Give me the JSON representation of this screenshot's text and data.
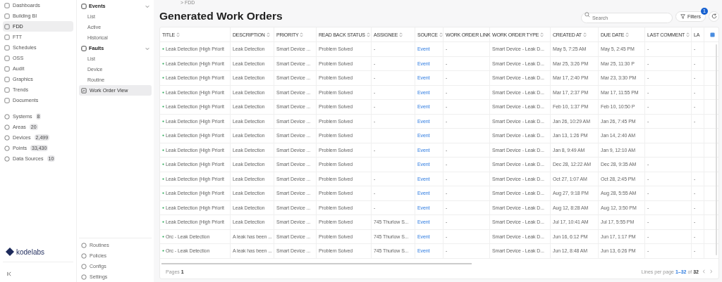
{
  "sidebar": {
    "items": [
      {
        "label": "Dashboards",
        "selected": false
      },
      {
        "label": "Building BI",
        "selected": false
      },
      {
        "label": "FDD",
        "selected": true
      },
      {
        "label": "FTT",
        "selected": false
      },
      {
        "label": "Schedules",
        "selected": false
      },
      {
        "label": "OSS",
        "selected": false
      },
      {
        "label": "Audit",
        "selected": false
      },
      {
        "label": "Graphics",
        "selected": false
      },
      {
        "label": "Trends",
        "selected": false
      },
      {
        "label": "Documents",
        "selected": false
      }
    ],
    "counters": [
      {
        "label": "Systems",
        "count": "8"
      },
      {
        "label": "Areas",
        "count": "20"
      },
      {
        "label": "Devices",
        "count": "2,499"
      },
      {
        "label": "Points",
        "count": "33,430"
      },
      {
        "label": "Data Sources",
        "count": "10"
      }
    ],
    "logo": "**kode**labs"
  },
  "subnav": {
    "groups": [
      {
        "label": "Events",
        "expanded": true,
        "children": [
          {
            "label": "List",
            "selected": false
          },
          {
            "label": "Active",
            "selected": false
          },
          {
            "label": "Historical",
            "selected": false
          }
        ]
      },
      {
        "label": "Faults",
        "expanded": true,
        "children": [
          {
            "label": "List",
            "selected": false
          },
          {
            "label": "Device",
            "selected": false
          },
          {
            "label": "Routine",
            "selected": false
          }
        ]
      }
    ],
    "items": [
      {
        "label": "Work Order View",
        "selected": true
      }
    ],
    "bottom": [
      "Routines",
      "Policies",
      "Configs",
      "Settings"
    ]
  },
  "breadcrumb": "> FDD",
  "title": "Generated Work Orders",
  "search": {
    "placeholder": "Search"
  },
  "filters": {
    "label": "Filters",
    "badge": "1"
  },
  "table": {
    "columns": [
      {
        "label": "TITLE",
        "sortable": true
      },
      {
        "label": "DESCRIPTION",
        "sortable": true
      },
      {
        "label": "PRIORITY",
        "sortable": true
      },
      {
        "label": "READ BACK STATUS",
        "sortable": true
      },
      {
        "label": "ASSIGNEE",
        "sortable": true
      },
      {
        "label": "SOURCE",
        "sortable": true
      },
      {
        "label": "WORK ORDER LINK",
        "sortable": false
      },
      {
        "label": "WORK ORDER TYPE",
        "sortable": true
      },
      {
        "label": "CREATED AT",
        "sortable": true
      },
      {
        "label": "DUE DATE",
        "sortable": true
      },
      {
        "label": "LAST COMMENT",
        "sortable": true
      },
      {
        "label": "LA",
        "sortable": false
      }
    ],
    "rows": [
      [
        "Leak Detection (High Priorit",
        "Leak Detection",
        "Smart Device ...",
        "Problem Solved",
        "-",
        "Event",
        "-",
        "Smart Device - Leak D...",
        "May 5, 7:25 AM",
        "May 5, 2:45 PM",
        "-",
        "-"
      ],
      [
        "Leak Detection (High Priorit",
        "Leak Detection",
        "Smart Device ...",
        "Problem Solved",
        "-",
        "Event",
        "-",
        "Smart Device - Leak D...",
        "Mar 25, 3:26 PM",
        "Mar 25, 11:30 P",
        "-",
        "-"
      ],
      [
        "Leak Detection (High Priorit",
        "Leak Detection",
        "Smart Device ...",
        "Problem Solved",
        "-",
        "Event",
        "-",
        "Smart Device - Leak D...",
        "Mar 17, 2:40 PM",
        "Mar 23, 3:30 PM",
        "-",
        "-"
      ],
      [
        "Leak Detection (High Priorit",
        "Leak Detection",
        "Smart Device ...",
        "Problem Solved",
        "-",
        "Event",
        "-",
        "Smart Device - Leak D...",
        "Mar 17, 2:37 PM",
        "Mar 17, 11:55 PM",
        "-",
        "-"
      ],
      [
        "Leak Detection (High Priorit",
        "Leak Detection",
        "Smart Device ...",
        "Problem Solved",
        "-",
        "Event",
        "-",
        "Smart Device - Leak D...",
        "Feb 10, 1:37 PM",
        "Feb 10, 10:50 P",
        "-",
        "-"
      ],
      [
        "Leak Detection (High Priorit",
        "Leak Detection",
        "Smart Device ...",
        "Problem Solved",
        "-",
        "Event",
        "-",
        "Smart Device - Leak D...",
        "Jan 26, 10:29 AM",
        "Jan 26, 7:45 PM",
        "-",
        "-"
      ],
      [
        "Leak Detection (High Priorit",
        "Leak Detection",
        "Smart Device ...",
        "Problem Solved",
        "",
        "Event",
        "",
        "Smart Device - Leak D...",
        "Jan 13, 1:26 PM",
        "Jan 14, 2:40 AM",
        "",
        ""
      ],
      [
        "Leak Detection (High Priorit",
        "Leak Detection",
        "Smart Device ...",
        "Problem Solved",
        "-",
        "Event",
        "-",
        "Smart Device - Leak D...",
        "Jan 8, 9:49 AM",
        "Jan 9, 12:10 AM",
        "",
        ""
      ],
      [
        "Leak Detection (High Priorit",
        "Leak Detection",
        "Smart Device ...",
        "Problem Solved",
        "",
        "Event",
        "-",
        "Smart Device - Leak D...",
        "Dec 28, 12:22 AM",
        "Dec 28, 9:35 AM",
        "-",
        ""
      ],
      [
        "Leak Detection (High Priorit",
        "Leak Detection",
        "Smart Device ...",
        "Problem Solved",
        "-",
        "Event",
        "-",
        "Smart Device - Leak D...",
        "Oct 27, 1:07 AM",
        "Oct 28, 2:45 PM",
        "-",
        "-"
      ],
      [
        "Leak Detection (High Priorit",
        "Leak Detection",
        "Smart Device ...",
        "Problem Solved",
        "-",
        "Event",
        "-",
        "Smart Device - Leak D...",
        "Aug 27, 9:18 PM",
        "Aug 28, 5:55 AM",
        "-",
        "-"
      ],
      [
        "Leak Detection (High Priorit",
        "Leak Detection",
        "Smart Device ...",
        "Problem Solved",
        "-",
        "Event",
        "-",
        "Smart Device - Leak D...",
        "Aug 12, 8:28 AM",
        "Aug 12, 3:50 PM",
        "-",
        "-"
      ],
      [
        "Leak Detection (High Priorit",
        "Leak Detection",
        "Smart Device ...",
        "Problem Solved",
        "745 Thurlow S...",
        "Event",
        "-",
        "Smart Device - Leak D...",
        "Jul 17, 10:41 AM",
        "Jul 17, 5:55 PM",
        "-",
        "-"
      ],
      [
        "Orc - Leak Detection",
        "A leak has been ...",
        "Smart Device ...",
        "Problem Solved",
        "745 Thurlow S...",
        "Event",
        "-",
        "Smart Device - Leak D...",
        "Jun 16, 6:12 PM",
        "Jun 17, 1:17 PM",
        "-",
        "-"
      ],
      [
        "Orc - Leak Detection",
        "A leak has been ...",
        "Smart Device ...",
        "Problem Solved",
        "745 Thurlow S...",
        "Event",
        "-",
        "Smart Device - Leak D...",
        "Jun 12, 8:48 AM",
        "Jun 13, 6:26 PM",
        "-",
        "-"
      ]
    ]
  },
  "footer": {
    "pages_label": "Pages",
    "page": "1",
    "lines_label": "Lines per page",
    "range": "1–32",
    "of": "of",
    "total": "32"
  }
}
